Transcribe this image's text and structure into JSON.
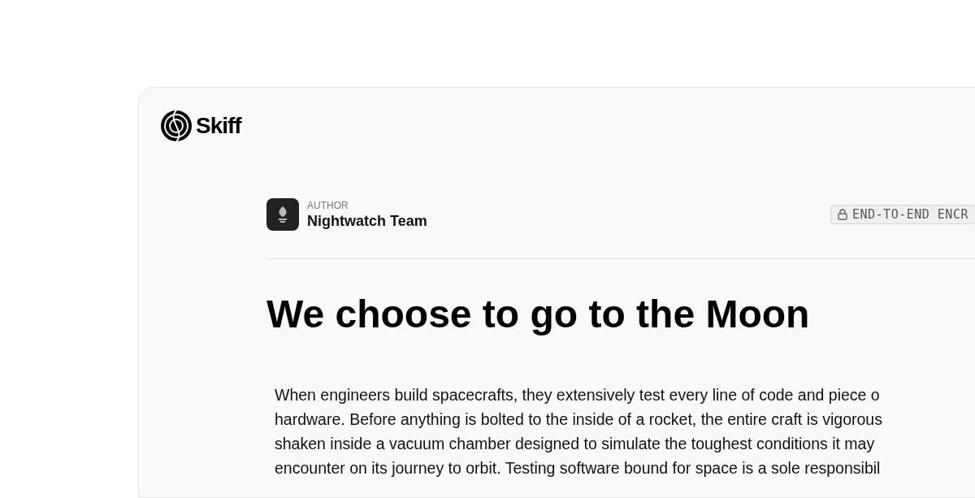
{
  "logo": {
    "text": "Skiff"
  },
  "author": {
    "label": "AUTHOR",
    "name": "Nightwatch Team"
  },
  "badge": {
    "text": "END-TO-END ENCR"
  },
  "title": "We choose to go to the Moon",
  "body_lines": [
    "When engineers build spacecrafts, they extensively test every line of code and piece o",
    "hardware. Before anything is bolted to the inside of a rocket, the entire craft is vigorous",
    "shaken inside a vacuum chamber designed to simulate the toughest conditions it may",
    "encounter on its journey to orbit. Testing software bound for space is a sole responsibil"
  ]
}
